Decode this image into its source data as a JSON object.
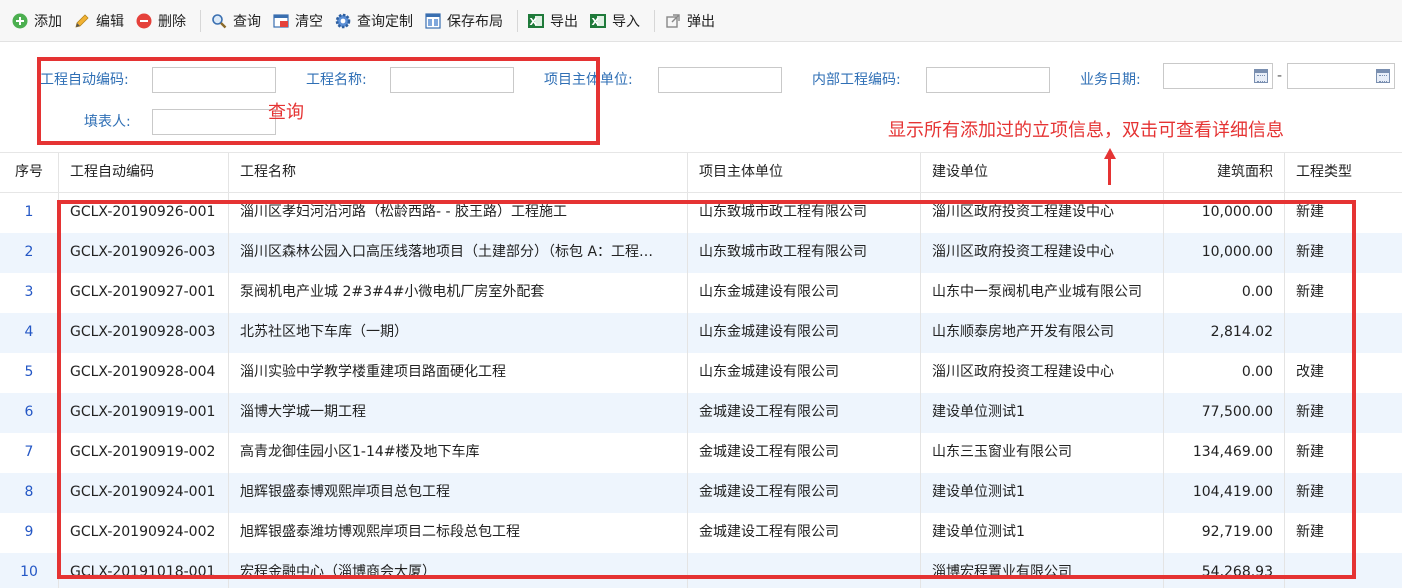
{
  "toolbar": {
    "buttons": [
      {
        "label": "添加",
        "icon": "add-icon"
      },
      {
        "label": "编辑",
        "icon": "edit-icon"
      },
      {
        "label": "删除",
        "icon": "delete-icon"
      },
      {
        "label": "查询",
        "icon": "search-icon"
      },
      {
        "label": "清空",
        "icon": "clear-icon"
      },
      {
        "label": "查询定制",
        "icon": "gear-icon"
      },
      {
        "label": "保存布局",
        "icon": "save-layout-icon"
      },
      {
        "label": "导出",
        "icon": "excel-export-icon"
      },
      {
        "label": "导入",
        "icon": "excel-import-icon"
      },
      {
        "label": "弹出",
        "icon": "popup-icon"
      }
    ]
  },
  "search": {
    "auto_code_label": "工程自动编码:",
    "auto_code_value": "",
    "project_name_label": "工程名称:",
    "project_name_value": "",
    "main_unit_label": "项目主体单位:",
    "main_unit_value": "",
    "internal_code_label": "内部工程编码:",
    "internal_code_value": "",
    "biz_date_label": "业务日期:",
    "biz_date_from": "",
    "biz_date_to": "",
    "date_separator": "-",
    "filler_label": "填表人:",
    "filler_value": ""
  },
  "annotations": {
    "query_note": "查询",
    "grid_note": "显示所有添加过的立项信息，双击可查看详细信息",
    "color": "#e53333"
  },
  "grid": {
    "headers": [
      "序号",
      "工程自动编码",
      "工程名称",
      "项目主体单位",
      "建设单位",
      "建筑面积",
      "工程类型"
    ],
    "rows": [
      [
        "1",
        "GCLX-20190926-001",
        "淄川区孝妇河沿河路（松龄西路- - 胶王路）工程施工",
        "山东致城市政工程有限公司",
        "淄川区政府投资工程建设中心",
        "10,000.00",
        "新建"
      ],
      [
        "2",
        "GCLX-20190926-003",
        "淄川区森林公园入口高压线落地项目（土建部分）（标包 A：工程…",
        "山东致城市政工程有限公司",
        "淄川区政府投资工程建设中心",
        "10,000.00",
        "新建"
      ],
      [
        "3",
        "GCLX-20190927-001",
        "泵阀机电产业城 2#3#4#小微电机厂房室外配套",
        "山东金城建设有限公司",
        "山东中一泵阀机电产业城有限公司",
        "0.00",
        "新建"
      ],
      [
        "4",
        "GCLX-20190928-003",
        "北苏社区地下车库（一期）",
        "山东金城建设有限公司",
        "山东顺泰房地产开发有限公司",
        "2,814.02",
        ""
      ],
      [
        "5",
        "GCLX-20190928-004",
        "淄川实验中学教学楼重建项目路面硬化工程",
        "山东金城建设有限公司",
        "淄川区政府投资工程建设中心",
        "0.00",
        "改建"
      ],
      [
        "6",
        "GCLX-20190919-001",
        "淄博大学城一期工程",
        "金城建设工程有限公司",
        "建设单位测试1",
        "77,500.00",
        "新建"
      ],
      [
        "7",
        "GCLX-20190919-002",
        "高青龙御佳园小区1-14#楼及地下车库",
        "金城建设工程有限公司",
        "山东三玉窗业有限公司",
        "134,469.00",
        "新建"
      ],
      [
        "8",
        "GCLX-20190924-001",
        "旭辉银盛泰博观熙岸项目总包工程",
        "金城建设工程有限公司",
        "建设单位测试1",
        "104,419.00",
        "新建"
      ],
      [
        "9",
        "GCLX-20190924-002",
        "旭辉银盛泰潍坊博观熙岸项目二标段总包工程",
        "金城建设工程有限公司",
        "建设单位测试1",
        "92,719.00",
        "新建"
      ],
      [
        "10",
        "GCLX-20191018-001",
        "宏程金融中心（淄博商会大厦）",
        "",
        "淄博宏程置业有限公司",
        "54,268.93",
        ""
      ]
    ]
  }
}
